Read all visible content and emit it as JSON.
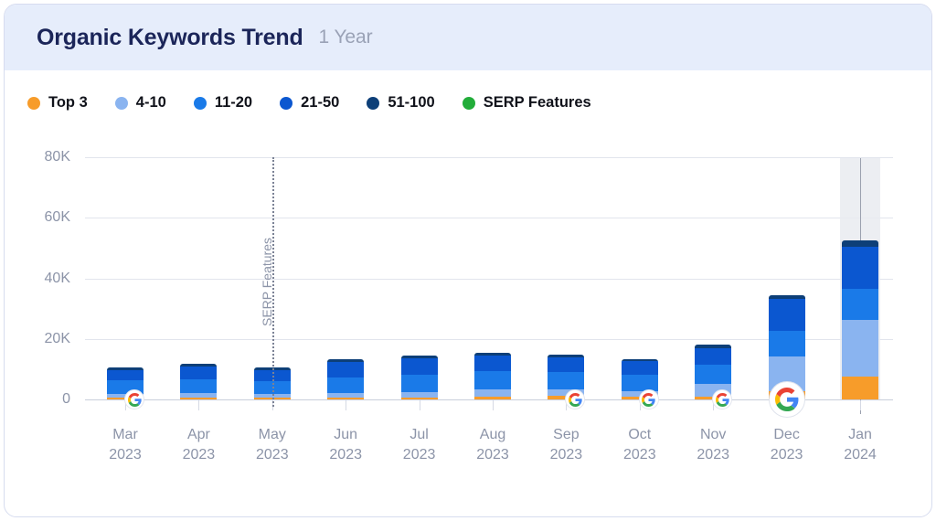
{
  "header": {
    "title": "Organic Keywords Trend",
    "period": "1 Year"
  },
  "legend": {
    "items": [
      {
        "label": "Top 3",
        "color": "#f79c2a"
      },
      {
        "label": "4-10",
        "color": "#8ab4f0"
      },
      {
        "label": "11-20",
        "color": "#1a7ae8"
      },
      {
        "label": "21-50",
        "color": "#0b57d0"
      },
      {
        "label": "51-100",
        "color": "#0d3f78"
      },
      {
        "label": "SERP Features",
        "color": "#22ad3a"
      }
    ]
  },
  "annotation": {
    "label": "SERP Features",
    "at_category": "May\n2023"
  },
  "marker": {
    "name": "google-update-marker",
    "categories": [
      "Mar 2023",
      "Sep 2023",
      "Oct 2023",
      "Nov 2023",
      "Dec 2023"
    ],
    "highlighted": "Dec 2023"
  },
  "chart_data": {
    "type": "bar",
    "title": "Organic Keywords Trend",
    "subtitle": "1 Year",
    "stacked": true,
    "grid": true,
    "legend_position": "top-left",
    "xlabel": "",
    "ylabel": "",
    "ylim": [
      0,
      80000
    ],
    "yticks": [
      0,
      20000,
      40000,
      60000,
      80000
    ],
    "ytick_labels": [
      "0",
      "20K",
      "40K",
      "60K",
      "80K"
    ],
    "categories": [
      "Mar 2023",
      "Apr 2023",
      "May 2023",
      "Jun 2023",
      "Jul 2023",
      "Aug 2023",
      "Sep 2023",
      "Oct 2023",
      "Nov 2023",
      "Dec 2023",
      "Jan 2024"
    ],
    "category_lines": [
      [
        "Mar",
        "2023"
      ],
      [
        "Apr",
        "2023"
      ],
      [
        "May",
        "2023"
      ],
      [
        "Jun",
        "2023"
      ],
      [
        "Jul",
        "2023"
      ],
      [
        "Aug",
        "2023"
      ],
      [
        "Sep",
        "2023"
      ],
      [
        "Oct",
        "2023"
      ],
      [
        "Nov",
        "2023"
      ],
      [
        "Dec",
        "2023"
      ],
      [
        "Jan",
        "2024"
      ]
    ],
    "series": [
      {
        "name": "Top 3",
        "color": "#f79c2a",
        "values": [
          600,
          600,
          500,
          600,
          700,
          800,
          1100,
          900,
          1000,
          2600,
          7400
        ]
      },
      {
        "name": "4-10",
        "color": "#8ab4f0",
        "values": [
          1300,
          1400,
          1200,
          1500,
          1700,
          2400,
          2300,
          1900,
          4200,
          11600,
          18800
        ]
      },
      {
        "name": "11-20",
        "color": "#1a7ae8",
        "values": [
          4300,
          4700,
          4200,
          5200,
          5700,
          6100,
          5800,
          5200,
          6300,
          8400,
          10200
        ]
      },
      {
        "name": "21-50",
        "color": "#0b57d0",
        "values": [
          3600,
          4200,
          3800,
          5000,
          5400,
          5200,
          4700,
          4600,
          5500,
          10600,
          14000
        ]
      },
      {
        "name": "51-100",
        "color": "#0d3f78",
        "values": [
          800,
          900,
          800,
          1100,
          1100,
          1000,
          900,
          800,
          1000,
          1200,
          2100
        ]
      }
    ],
    "totals": [
      10600,
      11800,
      10500,
      13400,
      14600,
      15500,
      14800,
      13400,
      18000,
      34400,
      52500
    ]
  }
}
